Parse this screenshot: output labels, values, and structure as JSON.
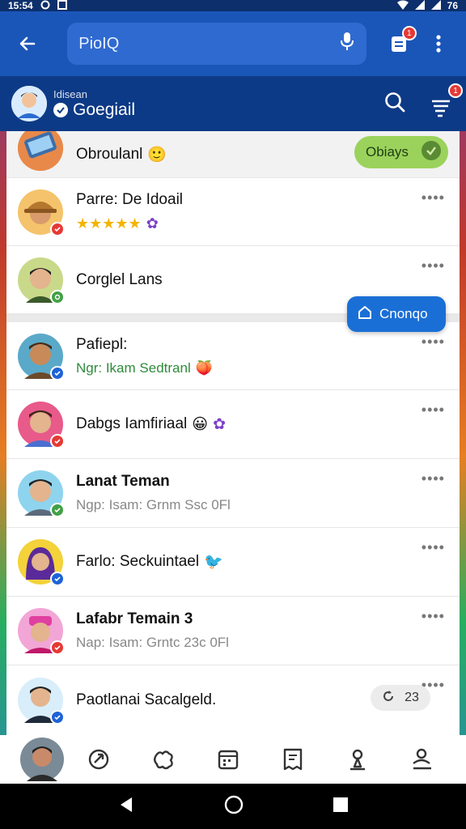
{
  "status_bar": {
    "time": "15:54",
    "battery": "76"
  },
  "app_bar": {
    "search_text": "PioIQ",
    "notification_count": "1"
  },
  "profile": {
    "subtitle": "Idisean",
    "name": "Goegiail",
    "notification_count": "1"
  },
  "rows": [
    {
      "title": "Obroulanl",
      "emoji": "🙂",
      "action_label": "Obiays"
    },
    {
      "title": "Parre: De Idoail",
      "stars": "★★★★★",
      "badge": "✿"
    },
    {
      "title": "Corglel Lans"
    },
    {
      "title": "Pafiepl:",
      "subtitle": "Ngr: Ikam Sedtranl",
      "emoji": "🍑"
    },
    {
      "title": "Dabgs Iamfiriaal",
      "emoji": "😀",
      "badge": "✿"
    },
    {
      "title": "Lanat Teman",
      "subtitle": "Ngp: Isam: Grnm Ssc 0Fl"
    },
    {
      "title": "Farlo: Seckuintael",
      "emoji": "🐦"
    },
    {
      "title": "Lafabr Temain 3",
      "subtitle": "Nap: Isam: Grntc 23c 0Fl"
    },
    {
      "title": "Paotlanai Sacalgeld.",
      "count": "23"
    }
  ],
  "fab": {
    "label": "Cnonqo"
  },
  "more_label": "••••",
  "colors": {
    "app_bar": "#1a56b8",
    "profile_bar": "#0d3a86",
    "accent_green": "#9bd25c",
    "fab_blue": "#1a6fd6",
    "badge_red": "#e53935"
  },
  "icons": {
    "app_bar": [
      "back-arrow-icon",
      "microphone-icon",
      "document-icon",
      "more-vert-icon"
    ],
    "profile_bar": [
      "search-icon",
      "filter-icon"
    ],
    "bottom_nav": [
      "avatar",
      "sync-icon",
      "puzzle-icon",
      "calendar-icon",
      "receipt-icon",
      "pin-icon",
      "person-list-icon"
    ],
    "system_nav": [
      "back-triangle-icon",
      "home-circle-icon",
      "recents-square-icon"
    ]
  }
}
